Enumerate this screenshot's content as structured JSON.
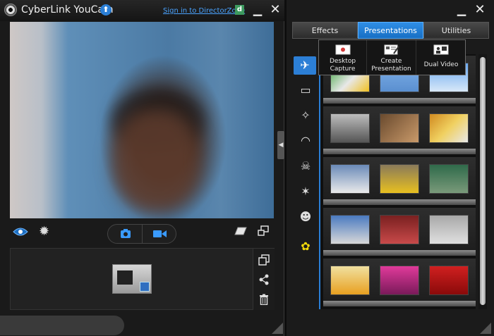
{
  "left_window": {
    "title": "CyberLink YouCam",
    "signin_link": "Sign in to DirectorZone",
    "dz_badge": "d",
    "update_glyph": "⬆",
    "minimize_glyph": "▁",
    "close_glyph": "✕",
    "gear_glyph": "✹"
  },
  "right_window": {
    "minimize_glyph": "▁",
    "close_glyph": "✕"
  },
  "tabs": [
    {
      "label": "Effects",
      "selected": false
    },
    {
      "label": "Presentations",
      "selected": true
    },
    {
      "label": "Utilities",
      "selected": false
    }
  ],
  "presentation_menu": [
    {
      "label_line1": "Desktop",
      "label_line2": "Capture",
      "icon": "desktop-capture-icon"
    },
    {
      "label_line1": "Create",
      "label_line2": "Presentation",
      "icon": "create-presentation-icon"
    },
    {
      "label_line1": "Dual Video",
      "label_line2": "",
      "icon": "dual-video-icon"
    }
  ],
  "sidebar_icons": [
    {
      "name": "frames-icon",
      "glyph": "✈",
      "selected": true
    },
    {
      "name": "scenes-icon",
      "glyph": "▭",
      "selected": false
    },
    {
      "name": "magic-wand-icon",
      "glyph": "✧",
      "selected": false
    },
    {
      "name": "mask-icon",
      "glyph": "◠",
      "selected": false
    },
    {
      "name": "avatar-icon",
      "glyph": "☠",
      "selected": false
    },
    {
      "name": "emotion-icon",
      "glyph": "✶",
      "selected": false
    },
    {
      "name": "smiley-icon",
      "glyph": "☻",
      "selected": false
    },
    {
      "name": "gadget-icon",
      "glyph": "✿",
      "selected": false
    }
  ],
  "colors": {
    "accent": "#2b86e0",
    "window_bg": "#1a1a1a",
    "title_text": "#f0f0f0",
    "link": "#4aa3ff"
  }
}
